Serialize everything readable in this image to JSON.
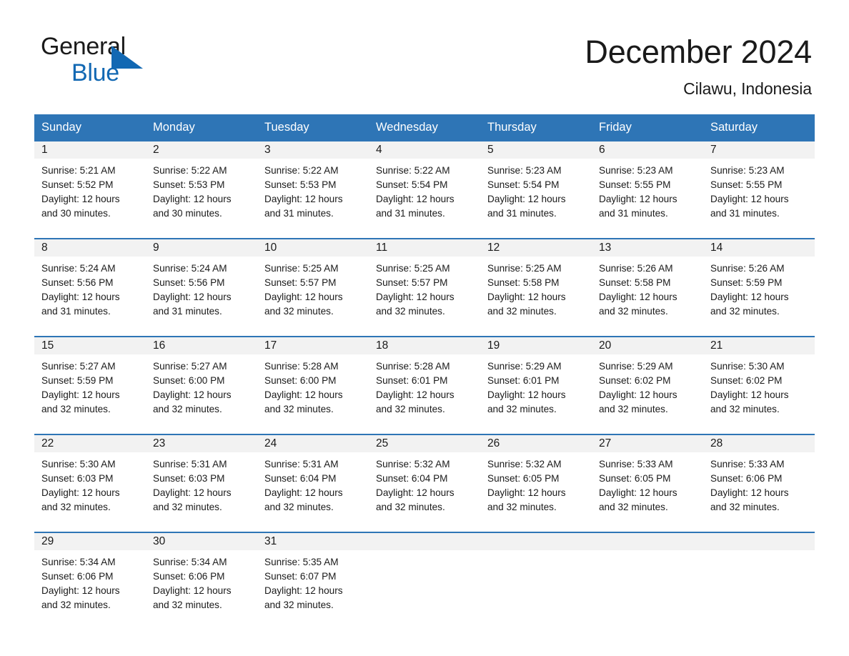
{
  "logo": {
    "word_one": "General",
    "word_two": "Blue",
    "triangle_color": "#1268b3",
    "text_color": "#1a1a1a"
  },
  "header": {
    "month_title": "December 2024",
    "location": "Cilawu, Indonesia"
  },
  "colors": {
    "header_blue": "#2e75b6",
    "day_band_gray": "#f2f2f2",
    "cell_white": "#ffffff",
    "text": "#1a1a1a"
  },
  "calendar": {
    "weekdays": [
      "Sunday",
      "Monday",
      "Tuesday",
      "Wednesday",
      "Thursday",
      "Friday",
      "Saturday"
    ],
    "weeks": [
      [
        {
          "day": "1",
          "sunrise": "Sunrise: 5:21 AM",
          "sunset": "Sunset: 5:52 PM",
          "daylight_line1": "Daylight: 12 hours",
          "daylight_line2": "and 30 minutes."
        },
        {
          "day": "2",
          "sunrise": "Sunrise: 5:22 AM",
          "sunset": "Sunset: 5:53 PM",
          "daylight_line1": "Daylight: 12 hours",
          "daylight_line2": "and 30 minutes."
        },
        {
          "day": "3",
          "sunrise": "Sunrise: 5:22 AM",
          "sunset": "Sunset: 5:53 PM",
          "daylight_line1": "Daylight: 12 hours",
          "daylight_line2": "and 31 minutes."
        },
        {
          "day": "4",
          "sunrise": "Sunrise: 5:22 AM",
          "sunset": "Sunset: 5:54 PM",
          "daylight_line1": "Daylight: 12 hours",
          "daylight_line2": "and 31 minutes."
        },
        {
          "day": "5",
          "sunrise": "Sunrise: 5:23 AM",
          "sunset": "Sunset: 5:54 PM",
          "daylight_line1": "Daylight: 12 hours",
          "daylight_line2": "and 31 minutes."
        },
        {
          "day": "6",
          "sunrise": "Sunrise: 5:23 AM",
          "sunset": "Sunset: 5:55 PM",
          "daylight_line1": "Daylight: 12 hours",
          "daylight_line2": "and 31 minutes."
        },
        {
          "day": "7",
          "sunrise": "Sunrise: 5:23 AM",
          "sunset": "Sunset: 5:55 PM",
          "daylight_line1": "Daylight: 12 hours",
          "daylight_line2": "and 31 minutes."
        }
      ],
      [
        {
          "day": "8",
          "sunrise": "Sunrise: 5:24 AM",
          "sunset": "Sunset: 5:56 PM",
          "daylight_line1": "Daylight: 12 hours",
          "daylight_line2": "and 31 minutes."
        },
        {
          "day": "9",
          "sunrise": "Sunrise: 5:24 AM",
          "sunset": "Sunset: 5:56 PM",
          "daylight_line1": "Daylight: 12 hours",
          "daylight_line2": "and 31 minutes."
        },
        {
          "day": "10",
          "sunrise": "Sunrise: 5:25 AM",
          "sunset": "Sunset: 5:57 PM",
          "daylight_line1": "Daylight: 12 hours",
          "daylight_line2": "and 32 minutes."
        },
        {
          "day": "11",
          "sunrise": "Sunrise: 5:25 AM",
          "sunset": "Sunset: 5:57 PM",
          "daylight_line1": "Daylight: 12 hours",
          "daylight_line2": "and 32 minutes."
        },
        {
          "day": "12",
          "sunrise": "Sunrise: 5:25 AM",
          "sunset": "Sunset: 5:58 PM",
          "daylight_line1": "Daylight: 12 hours",
          "daylight_line2": "and 32 minutes."
        },
        {
          "day": "13",
          "sunrise": "Sunrise: 5:26 AM",
          "sunset": "Sunset: 5:58 PM",
          "daylight_line1": "Daylight: 12 hours",
          "daylight_line2": "and 32 minutes."
        },
        {
          "day": "14",
          "sunrise": "Sunrise: 5:26 AM",
          "sunset": "Sunset: 5:59 PM",
          "daylight_line1": "Daylight: 12 hours",
          "daylight_line2": "and 32 minutes."
        }
      ],
      [
        {
          "day": "15",
          "sunrise": "Sunrise: 5:27 AM",
          "sunset": "Sunset: 5:59 PM",
          "daylight_line1": "Daylight: 12 hours",
          "daylight_line2": "and 32 minutes."
        },
        {
          "day": "16",
          "sunrise": "Sunrise: 5:27 AM",
          "sunset": "Sunset: 6:00 PM",
          "daylight_line1": "Daylight: 12 hours",
          "daylight_line2": "and 32 minutes."
        },
        {
          "day": "17",
          "sunrise": "Sunrise: 5:28 AM",
          "sunset": "Sunset: 6:00 PM",
          "daylight_line1": "Daylight: 12 hours",
          "daylight_line2": "and 32 minutes."
        },
        {
          "day": "18",
          "sunrise": "Sunrise: 5:28 AM",
          "sunset": "Sunset: 6:01 PM",
          "daylight_line1": "Daylight: 12 hours",
          "daylight_line2": "and 32 minutes."
        },
        {
          "day": "19",
          "sunrise": "Sunrise: 5:29 AM",
          "sunset": "Sunset: 6:01 PM",
          "daylight_line1": "Daylight: 12 hours",
          "daylight_line2": "and 32 minutes."
        },
        {
          "day": "20",
          "sunrise": "Sunrise: 5:29 AM",
          "sunset": "Sunset: 6:02 PM",
          "daylight_line1": "Daylight: 12 hours",
          "daylight_line2": "and 32 minutes."
        },
        {
          "day": "21",
          "sunrise": "Sunrise: 5:30 AM",
          "sunset": "Sunset: 6:02 PM",
          "daylight_line1": "Daylight: 12 hours",
          "daylight_line2": "and 32 minutes."
        }
      ],
      [
        {
          "day": "22",
          "sunrise": "Sunrise: 5:30 AM",
          "sunset": "Sunset: 6:03 PM",
          "daylight_line1": "Daylight: 12 hours",
          "daylight_line2": "and 32 minutes."
        },
        {
          "day": "23",
          "sunrise": "Sunrise: 5:31 AM",
          "sunset": "Sunset: 6:03 PM",
          "daylight_line1": "Daylight: 12 hours",
          "daylight_line2": "and 32 minutes."
        },
        {
          "day": "24",
          "sunrise": "Sunrise: 5:31 AM",
          "sunset": "Sunset: 6:04 PM",
          "daylight_line1": "Daylight: 12 hours",
          "daylight_line2": "and 32 minutes."
        },
        {
          "day": "25",
          "sunrise": "Sunrise: 5:32 AM",
          "sunset": "Sunset: 6:04 PM",
          "daylight_line1": "Daylight: 12 hours",
          "daylight_line2": "and 32 minutes."
        },
        {
          "day": "26",
          "sunrise": "Sunrise: 5:32 AM",
          "sunset": "Sunset: 6:05 PM",
          "daylight_line1": "Daylight: 12 hours",
          "daylight_line2": "and 32 minutes."
        },
        {
          "day": "27",
          "sunrise": "Sunrise: 5:33 AM",
          "sunset": "Sunset: 6:05 PM",
          "daylight_line1": "Daylight: 12 hours",
          "daylight_line2": "and 32 minutes."
        },
        {
          "day": "28",
          "sunrise": "Sunrise: 5:33 AM",
          "sunset": "Sunset: 6:06 PM",
          "daylight_line1": "Daylight: 12 hours",
          "daylight_line2": "and 32 minutes."
        }
      ],
      [
        {
          "day": "29",
          "sunrise": "Sunrise: 5:34 AM",
          "sunset": "Sunset: 6:06 PM",
          "daylight_line1": "Daylight: 12 hours",
          "daylight_line2": "and 32 minutes."
        },
        {
          "day": "30",
          "sunrise": "Sunrise: 5:34 AM",
          "sunset": "Sunset: 6:06 PM",
          "daylight_line1": "Daylight: 12 hours",
          "daylight_line2": "and 32 minutes."
        },
        {
          "day": "31",
          "sunrise": "Sunrise: 5:35 AM",
          "sunset": "Sunset: 6:07 PM",
          "daylight_line1": "Daylight: 12 hours",
          "daylight_line2": "and 32 minutes."
        },
        {
          "day": "",
          "sunrise": "",
          "sunset": "",
          "daylight_line1": "",
          "daylight_line2": ""
        },
        {
          "day": "",
          "sunrise": "",
          "sunset": "",
          "daylight_line1": "",
          "daylight_line2": ""
        },
        {
          "day": "",
          "sunrise": "",
          "sunset": "",
          "daylight_line1": "",
          "daylight_line2": ""
        },
        {
          "day": "",
          "sunrise": "",
          "sunset": "",
          "daylight_line1": "",
          "daylight_line2": ""
        }
      ]
    ]
  }
}
